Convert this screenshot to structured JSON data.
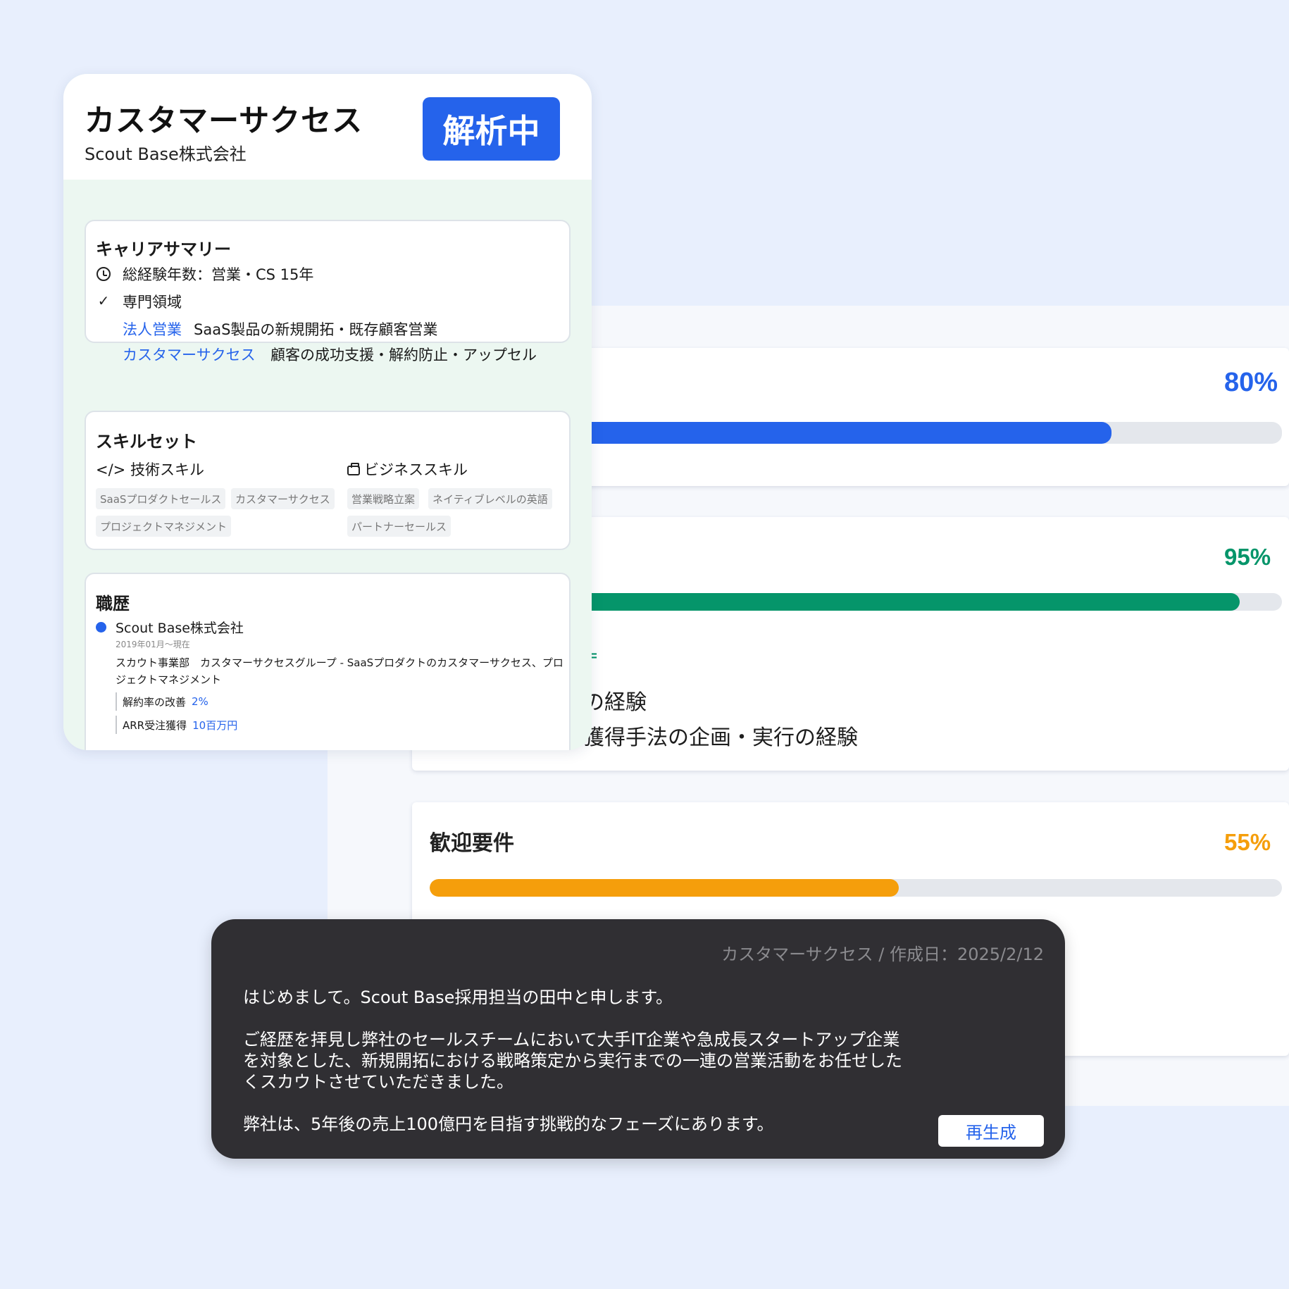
{
  "profile": {
    "job_title": "カスタマーサクセス",
    "company": "Scout Base株式会社",
    "status": "解析中",
    "career_summary": {
      "title": "キャリアサマリー",
      "experience": "総経験年数：営業・CS 15年",
      "specialty_label": "専門領域",
      "specialties": [
        {
          "label": "法人営業",
          "desc": "SaaS製品の新規開拓・既存顧客営業"
        },
        {
          "label": "カスタマーサクセス",
          "desc": "顧客の成功支援・解約防止・アップセル"
        }
      ]
    },
    "skillset": {
      "title": "スキルセット",
      "tech_title": "</> 技術スキル",
      "tech_tags": [
        "SaaSプロダクトセールス",
        "カスタマーサクセス",
        "プロジェクトマネジメント"
      ],
      "biz_title": "ビジネススキル",
      "biz_tags": [
        "営業戦略立案",
        "ネイティブレベルの英語",
        "パートナーセールス"
      ]
    },
    "history": {
      "title": "職歴",
      "company": "Scout Base株式会社",
      "period": "2019年01月〜現在",
      "description": "スカウト事業部　カスタマーサクセスグループ - SaaSプロダクトのカスタマーサクセス、プロジェクトマネジメント",
      "metrics": [
        {
          "label": "解約率の改善",
          "value": "2%"
        },
        {
          "label": "ARR受注獲得",
          "value": "10百万円"
        }
      ]
    }
  },
  "match": {
    "items": [
      {
        "percent_label": "80%",
        "value": 0.8,
        "color": "#2563eb"
      },
      {
        "percent_label": "95%",
        "value": 0.95,
        "color": "#05956a",
        "mark": "=",
        "lines": [
          "の経験",
          "獲得手法の企画・実行の経験"
        ]
      },
      {
        "title": "歓迎要件",
        "percent_label": "55%",
        "value": 0.55,
        "color": "#f59e0b"
      }
    ]
  },
  "message": {
    "meta": "カスタマーサクセス / 作成日：2025/2/12",
    "paragraphs": [
      "はじめまして。Scout Base採用担当の田中と申します。",
      "ご経歴を拝見し弊社のセールスチームにおいて大手IT企業や急成長スタートアップ企業を対象とした、新規開拓における戦略策定から実行までの一連の営業活動をお任せしたくスカウトさせていただきました。",
      "弊社は、5年後の売上100億円を目指す挑戦的なフェーズにあります。"
    ],
    "regenerate_label": "再生成"
  }
}
